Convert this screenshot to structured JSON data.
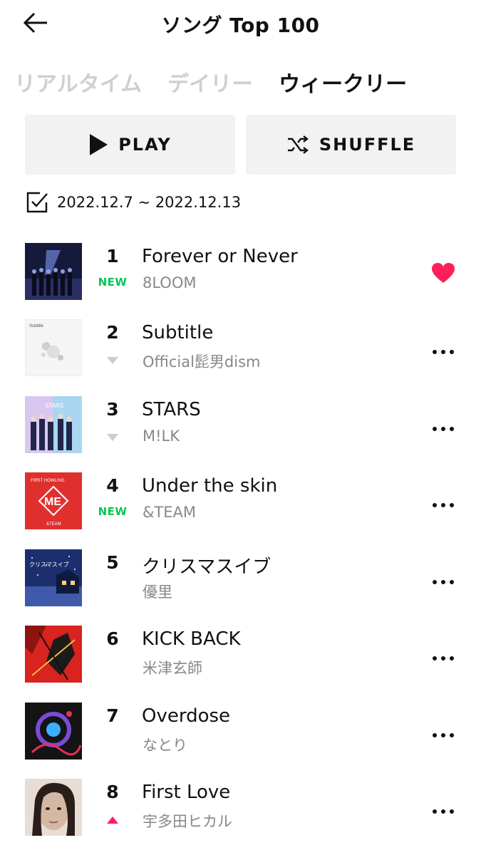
{
  "header": {
    "title": "ソング Top 100",
    "back_icon": "arrow-left-icon"
  },
  "tabs": [
    {
      "label": "リアルタイム",
      "active": false
    },
    {
      "label": "デイリー",
      "active": false
    },
    {
      "label": "ウィークリー",
      "active": true
    }
  ],
  "actions": {
    "play_label": "PLAY",
    "shuffle_label": "SHUFFLE"
  },
  "period": {
    "text": "2022.12.7 ~ 2022.12.13",
    "icon": "checkbox-icon"
  },
  "colors": {
    "accent_green": "#00c853",
    "liked_red": "#ff1e5a",
    "up_red": "#ff1e5a",
    "down_gray": "#cccccc",
    "tab_inactive": "#cfcfcf"
  },
  "songs": [
    {
      "rank": "1",
      "title": "Forever or Never",
      "artist": "8LOOM",
      "change": "NEW",
      "action": "heart"
    },
    {
      "rank": "2",
      "title": "Subtitle",
      "artist": "Official髭男dism",
      "change": "down",
      "action": "more"
    },
    {
      "rank": "3",
      "title": "STARS",
      "artist": "M!LK",
      "change": "down",
      "action": "more"
    },
    {
      "rank": "4",
      "title": "Under the skin",
      "artist": "&TEAM",
      "change": "NEW",
      "action": "more"
    },
    {
      "rank": "5",
      "title": "クリスマスイブ",
      "artist": "優里",
      "change": "",
      "action": "more"
    },
    {
      "rank": "6",
      "title": "KICK BACK",
      "artist": "米津玄師",
      "change": "",
      "action": "more"
    },
    {
      "rank": "7",
      "title": "Overdose",
      "artist": "なとり",
      "change": "",
      "action": "more"
    },
    {
      "rank": "8",
      "title": "First Love",
      "artist": "宇多田ヒカル",
      "change": "up",
      "action": "more"
    }
  ]
}
